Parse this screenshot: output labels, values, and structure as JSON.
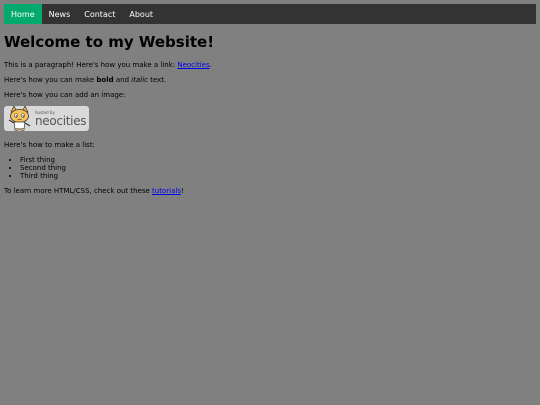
{
  "nav": {
    "items": [
      {
        "label": "Home",
        "active": true
      },
      {
        "label": "News",
        "active": false
      },
      {
        "label": "Contact",
        "active": false
      },
      {
        "label": "About",
        "active": false
      }
    ]
  },
  "main": {
    "heading": "Welcome to my Website!",
    "p1_before": "This is a paragraph! Here's how you make a link: ",
    "p1_link": "Neocities",
    "p1_after": ".",
    "p2_before": "Here's how you can make ",
    "p2_bold": "bold",
    "p2_mid": " and ",
    "p2_italic": "italic",
    "p2_after": " text.",
    "p3": "Here's how you can add an image:",
    "badge": {
      "small_text": "hosted by",
      "big_text": "neocities"
    },
    "p4": "Here's how to make a list:",
    "list": [
      "First thing",
      "Second thing",
      "Third thing"
    ],
    "p5_before": "To learn more HTML/CSS, check out these ",
    "p5_link": "tutorials",
    "p5_after": "!"
  },
  "colors": {
    "page_bg": "#808080",
    "navbar_bg": "#333333",
    "nav_active": "#04aa6d",
    "link": "#0000ee"
  }
}
